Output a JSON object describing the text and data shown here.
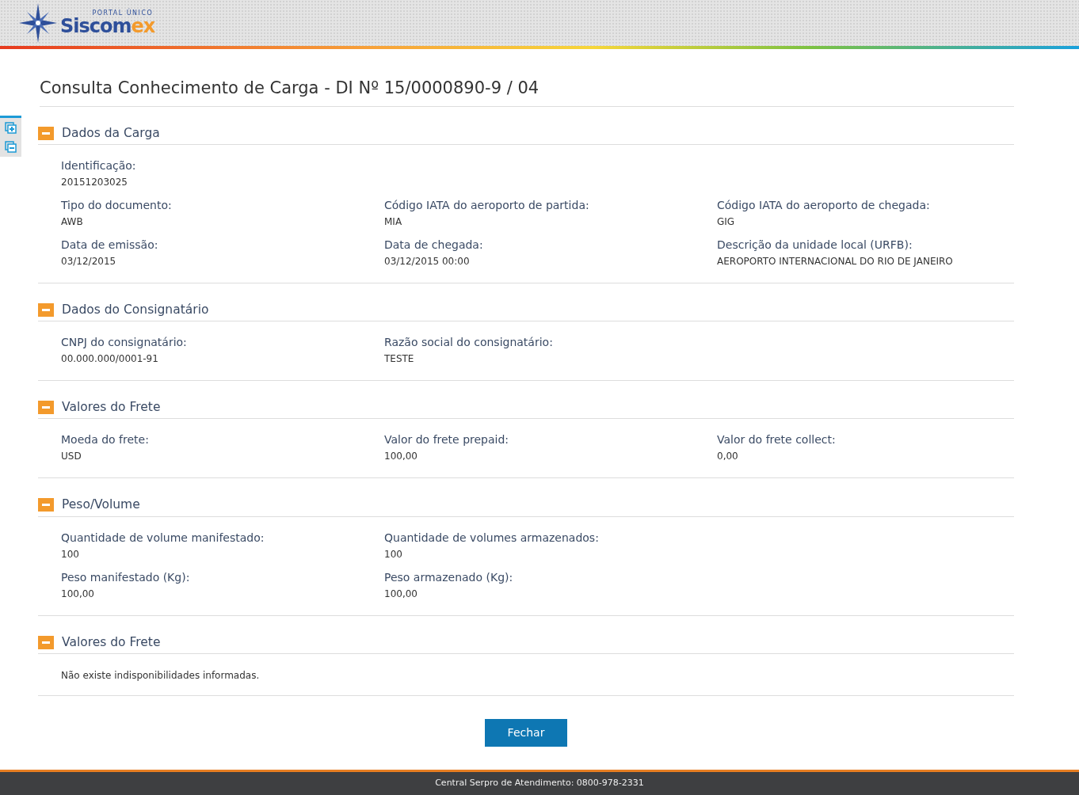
{
  "header": {
    "logo_top": "PORTAL ÚNICO",
    "logo_main": "Siscom",
    "logo_accent": "ex"
  },
  "title": "Consulta Conhecimento de Carga - DI Nº 15/0000890-9 / 04",
  "sections": [
    {
      "title": "Dados da Carga",
      "expanded": true,
      "kind": "fields",
      "rows": [
        [
          {
            "label": "Identificação:",
            "value": "20151203025"
          }
        ],
        [
          {
            "label": "Tipo do documento:",
            "value": "AWB"
          },
          {
            "label": "Código IATA do aeroporto de partida:",
            "value": "MIA"
          },
          {
            "label": "Código IATA do aeroporto de chegada:",
            "value": "GIG"
          }
        ],
        [
          {
            "label": "Data de emissão:",
            "value": "03/12/2015"
          },
          {
            "label": "Data de chegada:",
            "value": "03/12/2015 00:00"
          },
          {
            "label": "Descrição da unidade local (URFB):",
            "value": "AEROPORTO INTERNACIONAL DO RIO DE JANEIRO"
          }
        ]
      ]
    },
    {
      "title": "Dados do Consignatário",
      "expanded": true,
      "kind": "fields",
      "rows": [
        [
          {
            "label": "CNPJ do consignatário:",
            "value": "00.000.000/0001-91"
          },
          {
            "label": "Razão social do consignatário:",
            "value": "TESTE"
          }
        ]
      ]
    },
    {
      "title": "Valores do Frete",
      "expanded": true,
      "kind": "fields",
      "rows": [
        [
          {
            "label": "Moeda do frete:",
            "value": "USD"
          },
          {
            "label": "Valor do frete prepaid:",
            "value": "100,00"
          },
          {
            "label": "Valor do frete collect:",
            "value": "0,00"
          }
        ]
      ]
    },
    {
      "title": "Peso/Volume",
      "expanded": true,
      "kind": "fields",
      "rows": [
        [
          {
            "label": "Quantidade de volume manifestado:",
            "value": "100"
          },
          {
            "label": "Quantidade de volumes armazenados:",
            "value": "100"
          }
        ],
        [
          {
            "label": "Peso manifestado (Kg):",
            "value": "100,00"
          },
          {
            "label": "Peso armazenado (Kg):",
            "value": "100,00"
          }
        ]
      ]
    },
    {
      "title": "Valores do Frete",
      "expanded": true,
      "kind": "message",
      "message": "Não existe indisponibilidades informadas."
    }
  ],
  "close_button": "Fechar",
  "footer": "Central Serpro de Atendimento: 0800-978-2331"
}
